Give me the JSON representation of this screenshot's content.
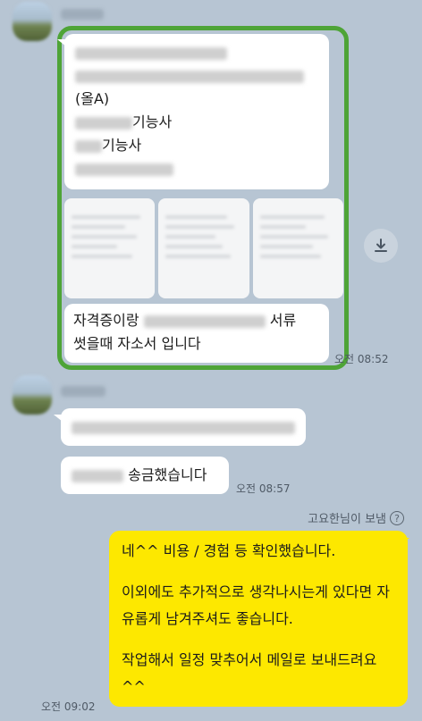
{
  "messages": {
    "m1": {
      "line3": "(올A)",
      "line4_suffix": "기능사",
      "line5_suffix": "기능사",
      "caption_prefix": "자격증이랑",
      "caption_suffix": "서류",
      "caption_line2": "썻을때 자소서 입니다",
      "time": "오전 08:52"
    },
    "m2": {
      "transfer_suffix": "송금했습니다",
      "time": "오전 08:57"
    },
    "m3": {
      "sent_by": "고요한님이 보냄",
      "help_glyph": "?",
      "para1": "네^^ 비용 / 경험 등 확인했습니다.",
      "para2": "이외에도 추가적으로 생각나시는게 있다면 자유롭게 남겨주셔도 좋습니다.",
      "para3": "작업해서 일정 맞추어서 메일로 보내드려요^^",
      "time": "오전 09:02"
    }
  },
  "colors": {
    "background": "#b7c5d3",
    "my_bubble": "#fde800",
    "their_bubble": "#ffffff",
    "highlight_border": "#4ea437"
  },
  "icons": {
    "download": "download-icon"
  }
}
